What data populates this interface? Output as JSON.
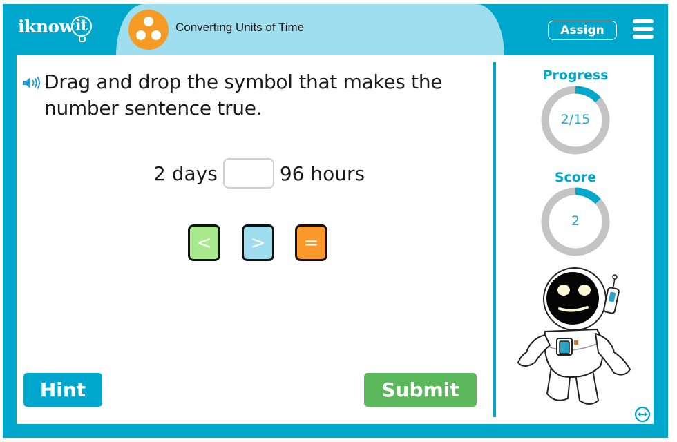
{
  "header": {
    "logo_text": "iknow",
    "logo_bulb_text": "it",
    "topic_title": "Converting Units of Time",
    "topic_icon": "three-dots-circle-icon",
    "assign_label": "Assign",
    "menu_icon": "hamburger-menu-icon"
  },
  "question": {
    "speaker_icon": "speaker-icon",
    "prompt": "Drag and drop the symbol that makes the number sentence true.",
    "left_term": "2 days",
    "right_term": "96 hours",
    "drop_value": ""
  },
  "symbols": [
    {
      "label": "<",
      "meaning": "less-than",
      "color": "#a8ea8b"
    },
    {
      "label": ">",
      "meaning": "greater-than",
      "color": "#9fdcee"
    },
    {
      "label": "=",
      "meaning": "equals",
      "color": "#f9992b"
    }
  ],
  "buttons": {
    "hint_label": "Hint",
    "submit_label": "Submit"
  },
  "sidebar": {
    "progress": {
      "label": "Progress",
      "text": "2/15",
      "current": 2,
      "total": 15
    },
    "score": {
      "label": "Score",
      "text": "2",
      "fraction": 0.1333
    },
    "mascot": "astronaut-mascot",
    "expand_icon": "expand-arrows-icon"
  },
  "colors": {
    "brand": "#00a7cc",
    "brand_light": "#9fdeee",
    "accent_orange": "#f59a23",
    "submit_green": "#5cb85c",
    "ring_gray": "#c4c4c4"
  }
}
